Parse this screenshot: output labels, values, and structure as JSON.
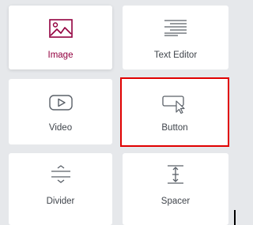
{
  "widgets": [
    {
      "label": "Image",
      "icon": "image-icon",
      "color": "#93003f"
    },
    {
      "label": "Text Editor",
      "icon": "text-editor-icon"
    },
    {
      "label": "Video",
      "icon": "video-play-icon"
    },
    {
      "label": "Button",
      "icon": "button-cursor-icon",
      "selected": true,
      "highlight_color": "#e00000"
    },
    {
      "label": "Divider",
      "icon": "divider-icon"
    },
    {
      "label": "Spacer",
      "icon": "spacer-icon"
    }
  ]
}
